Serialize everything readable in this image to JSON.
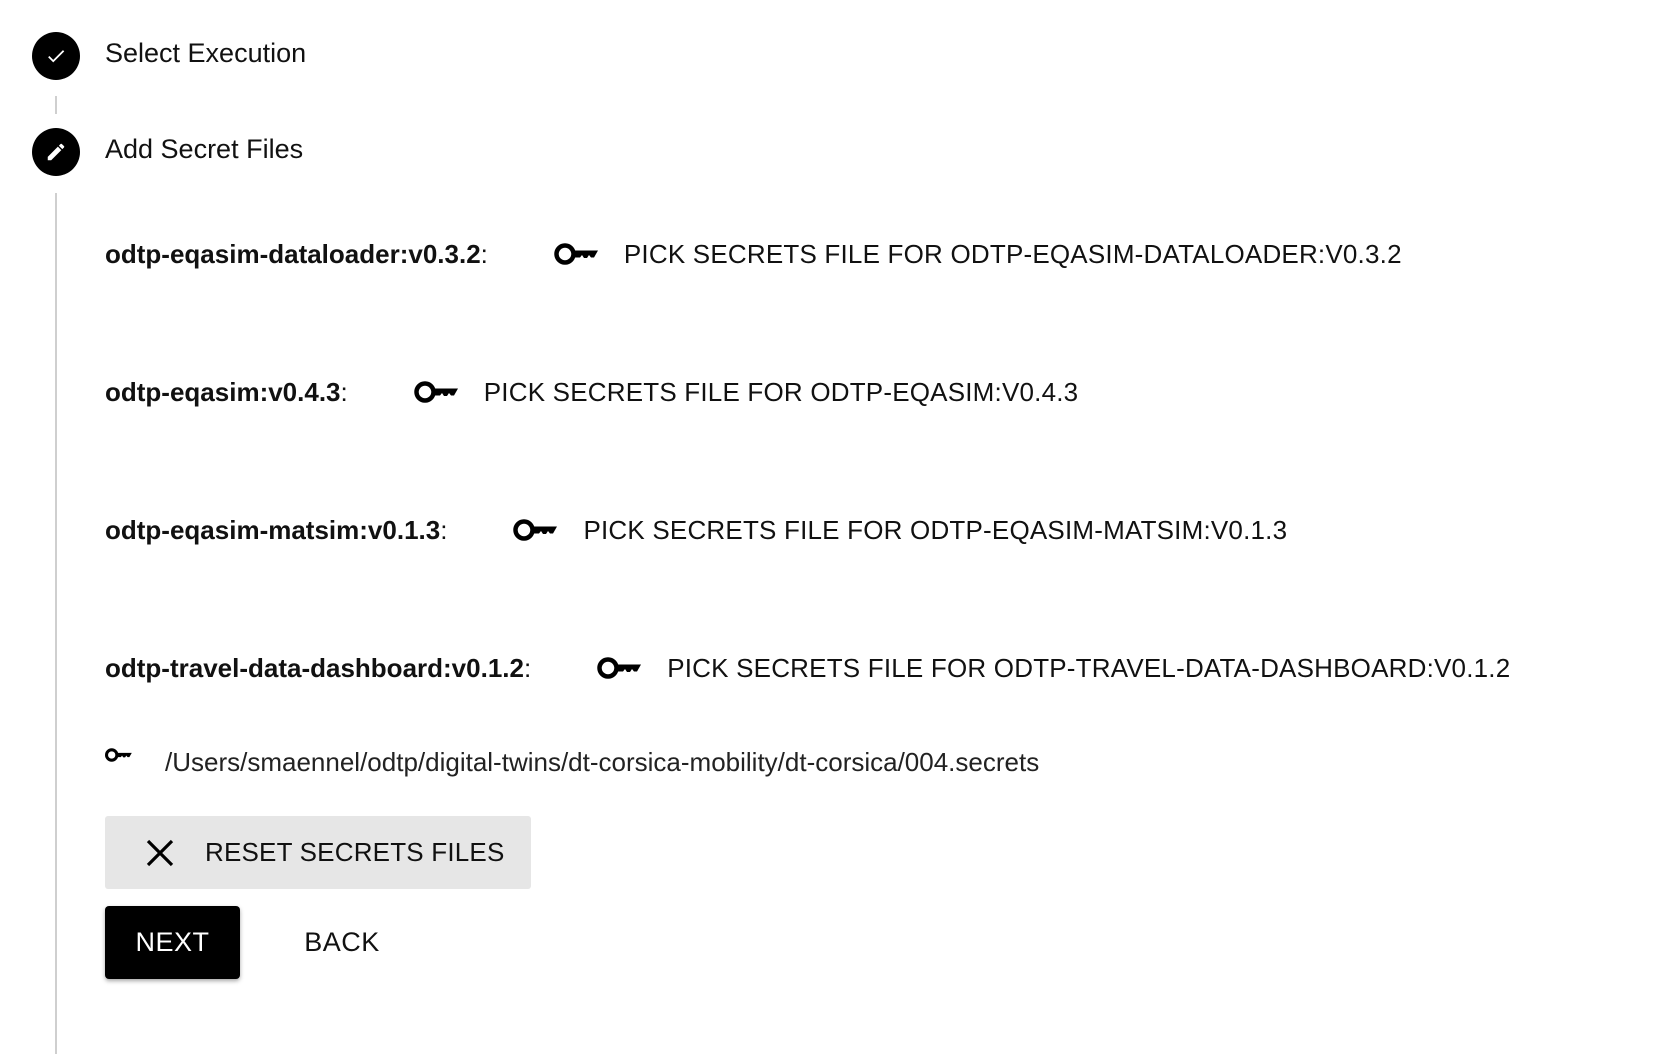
{
  "steps": [
    {
      "label": "Select Execution",
      "state": "completed",
      "icon": "check-icon"
    },
    {
      "label": "Add Secret Files",
      "state": "active",
      "icon": "pencil-icon"
    }
  ],
  "secret_rows": [
    {
      "name": "odtp-eqasim-dataloader:v0.3.2",
      "colon": ":",
      "button_label": "PICK SECRETS FILE FOR ODTP-EQASIM-DATALOADER:V0.3.2",
      "icon": "key-icon"
    },
    {
      "name": "odtp-eqasim:v0.4.3",
      "colon": ":",
      "button_label": "PICK SECRETS FILE FOR ODTP-EQASIM:V0.4.3",
      "icon": "key-icon"
    },
    {
      "name": "odtp-eqasim-matsim:v0.1.3",
      "colon": ":",
      "button_label": "PICK SECRETS FILE FOR ODTP-EQASIM-MATSIM:V0.1.3",
      "icon": "key-icon"
    },
    {
      "name": "odtp-travel-data-dashboard:v0.1.2",
      "colon": ":",
      "button_label": "PICK SECRETS FILE FOR ODTP-TRAVEL-DATA-DASHBOARD:V0.1.2",
      "icon": "key-icon"
    }
  ],
  "selected_file": {
    "icon": "key-icon",
    "path": "/Users/smaennel/odtp/digital-twins/dt-corsica-mobility/dt-corsica/004.secrets"
  },
  "actions": {
    "reset_label": "RESET SECRETS FILES",
    "reset_icon": "close-icon",
    "next_label": "NEXT",
    "back_label": "BACK"
  },
  "colors": {
    "accent": "#000000",
    "connector": "#cfcfcf",
    "reset_background": "#e6e6e6"
  }
}
